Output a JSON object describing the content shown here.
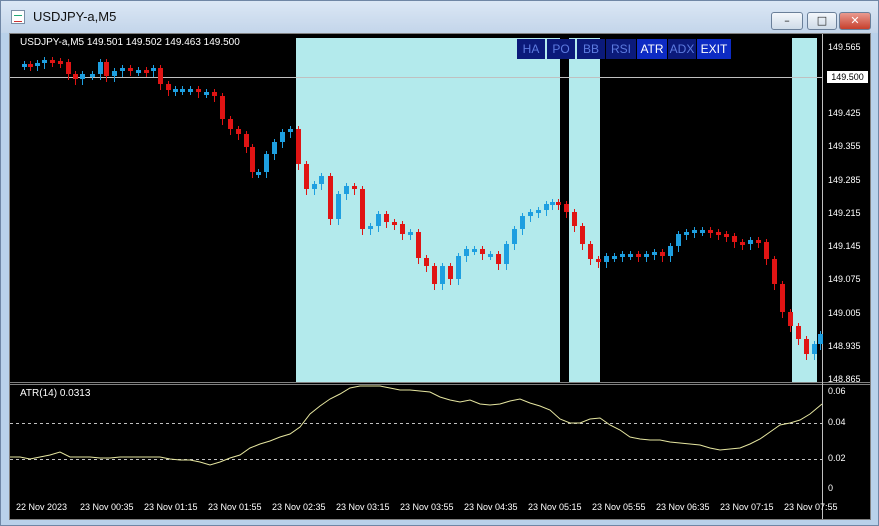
{
  "window": {
    "title": "USDJPY-a,M5",
    "buttons": [
      "minimize",
      "maximize",
      "close"
    ]
  },
  "chart": {
    "header": "USDJPY-a,M5  149.501 149.502 149.463 149.500",
    "current_price": "149.500",
    "price_labels": [
      "149.565",
      "149.495",
      "149.425",
      "149.355",
      "149.285",
      "149.215",
      "149.145",
      "149.075",
      "149.005",
      "148.935",
      "148.865"
    ],
    "indicator_buttons": [
      "HA",
      "PO",
      "BB",
      "RSI",
      "ATR",
      "ADX",
      "EXIT"
    ],
    "atr_label": "ATR(14) 0.0313",
    "atr_labels": [
      "0.06",
      "0.04",
      "0.02",
      "0"
    ],
    "time_labels": [
      "22 Nov 2023",
      "23 Nov 00:35",
      "23 Nov 01:15",
      "23 Nov 01:55",
      "23 Nov 02:35",
      "23 Nov 03:15",
      "23 Nov 03:55",
      "23 Nov 04:35",
      "23 Nov 05:15",
      "23 Nov 05:55",
      "23 Nov 06:35",
      "23 Nov 07:15",
      "23 Nov 07:55"
    ],
    "colors": {
      "bull": "#1e9fe0",
      "bear": "#e01414",
      "zone": "#b3eaec",
      "background": "#000000",
      "button_active": "#0d2bc4",
      "button_dim": "#0b1a7a"
    }
  }
}
